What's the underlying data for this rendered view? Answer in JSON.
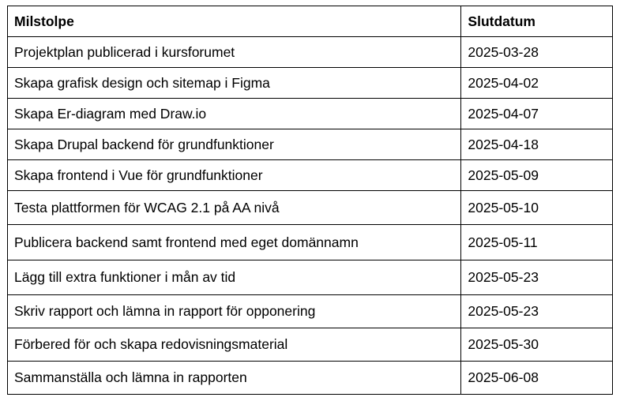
{
  "table": {
    "headers": [
      "Milstolpe",
      "Slutdatum"
    ],
    "rows": [
      {
        "milestone": "Projektplan publicerad i kursforumet",
        "date": "2025-03-28"
      },
      {
        "milestone": "Skapa grafisk design och sitemap i Figma",
        "date": "2025-04-02"
      },
      {
        "milestone": "Skapa Er-diagram med Draw.io",
        "date": "2025-04-07"
      },
      {
        "milestone": "Skapa Drupal backend för grundfunktioner",
        "date": "2025-04-18"
      },
      {
        "milestone": "Skapa frontend i Vue för grundfunktioner",
        "date": "2025-05-09"
      },
      {
        "milestone": "Testa plattformen för WCAG 2.1 på AA nivå",
        "date": "2025-05-10"
      },
      {
        "milestone": "Publicera backend samt frontend med eget domännamn",
        "date": "2025-05-11"
      },
      {
        "milestone": "Lägg till extra funktioner i mån av tid",
        "date": "2025-05-23"
      },
      {
        "milestone": "Skriv rapport och lämna in rapport för opponering",
        "date": "2025-05-23"
      },
      {
        "milestone": "Förbered för och skapa redovisningsmaterial",
        "date": "2025-05-30"
      },
      {
        "milestone": "Sammanställa och lämna in rapporten",
        "date": "2025-06-08"
      }
    ]
  }
}
